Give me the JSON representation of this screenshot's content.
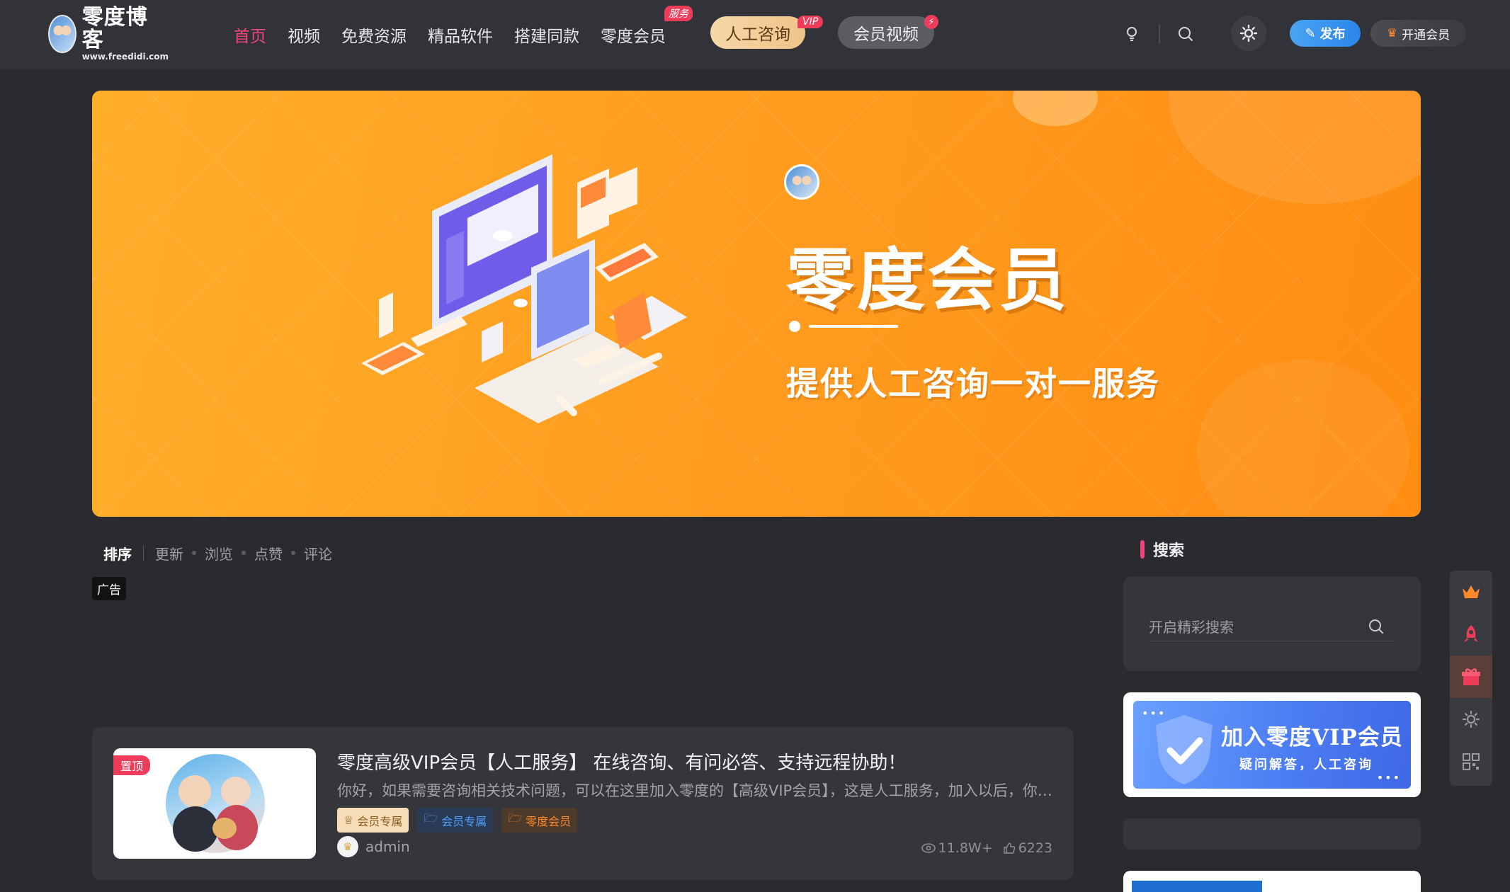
{
  "header": {
    "logo_title": "零度博客",
    "logo_sub": "www.freedidi.com",
    "nav": [
      {
        "label": "首页",
        "active": true
      },
      {
        "label": "视频"
      },
      {
        "label": "免费资源"
      },
      {
        "label": "精品软件"
      },
      {
        "label": "搭建同款"
      },
      {
        "label": "零度会员",
        "badge": "服务"
      }
    ],
    "consult_label": "人工咨询",
    "consult_badge": "VIP",
    "video_label": "会员视频",
    "publish_label": "发布",
    "member_label": "开通会员"
  },
  "banner": {
    "title": "零度会员",
    "subtitle": "提供人工咨询一对一服务"
  },
  "sort": {
    "label": "排序",
    "options": [
      "更新",
      "浏览",
      "点赞",
      "评论"
    ]
  },
  "ad_label": "广告",
  "post": {
    "pin_label": "置顶",
    "title": "零度高级VIP会员【人工服务】 在线咨询、有问必答、支持远程协助！",
    "excerpt": "你好，如果需要咨询相关技术问题，可以在这里加入零度的【高级VIP会员】，这是人工服务，加入以后，你可以获得远程协助、有问必答、技术支持等服务……",
    "tags": [
      "会员专属",
      "会员专属",
      "零度会员"
    ],
    "author": "admin",
    "views": "11.8W+",
    "likes": "6223"
  },
  "sidebar": {
    "search_title": "搜索",
    "search_placeholder": "开启精彩搜索",
    "vip_title": "加入零度VIP会员",
    "vip_sub": "疑问解答，人工咨询"
  },
  "colors": {
    "accent": "#f0457c",
    "banner": "#ff9c1f",
    "publish": "#2b86ea"
  }
}
